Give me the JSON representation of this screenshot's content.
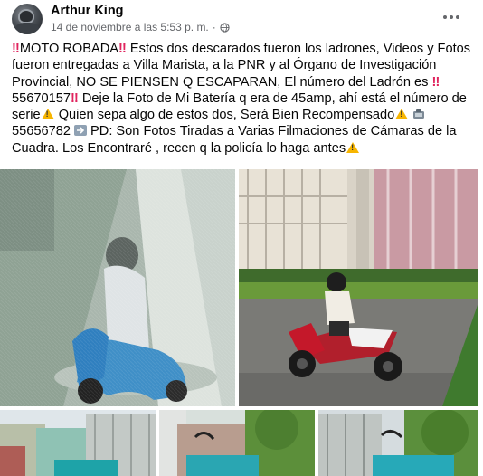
{
  "post": {
    "author": "Arthur King",
    "timestamp": "14 de noviembre a las 5:53 p. m.",
    "separator": "·",
    "privacy_icon": "globe-icon",
    "more_icon": "ellipsis-icon"
  },
  "text": {
    "s1": "MOTO ROBADA",
    "s2": " Estos dos descarados fueron los ladrones, Videos y Fotos fueron entregadas a Villa Marista, a la PNR y al Órgano de Investigación Provincial, NO SE PIENSEN Q ESCAPARAN, El número del Ladrón es ",
    "s3": " 55670157",
    "s4": " Deje la Foto de Mi Batería q era de 45amp, ahí está el número de serie",
    "s5": " Quien sepa algo de estos dos, Será Bien Recompensado",
    "s6": " 55656782",
    "s7": " PD: Son Fotos Tiradas a Varias Filmaciones de Cámaras de la Cuadra. Los Encontraré , recen q la policía lo haga antes"
  },
  "photos": [
    {
      "name": "photo-cctv-scooter-street",
      "icon": "photo"
    },
    {
      "name": "photo-scooter-rider-red",
      "icon": "photo"
    },
    {
      "name": "photo-blue-scooter-1",
      "icon": "photo"
    },
    {
      "name": "photo-blue-scooter-2",
      "icon": "photo"
    },
    {
      "name": "photo-blue-scooter-3",
      "icon": "photo"
    }
  ],
  "colors": {
    "name": "#050505",
    "meta": "#65676b",
    "emoji_red": "#e0245e",
    "warning": "#f7b500"
  }
}
